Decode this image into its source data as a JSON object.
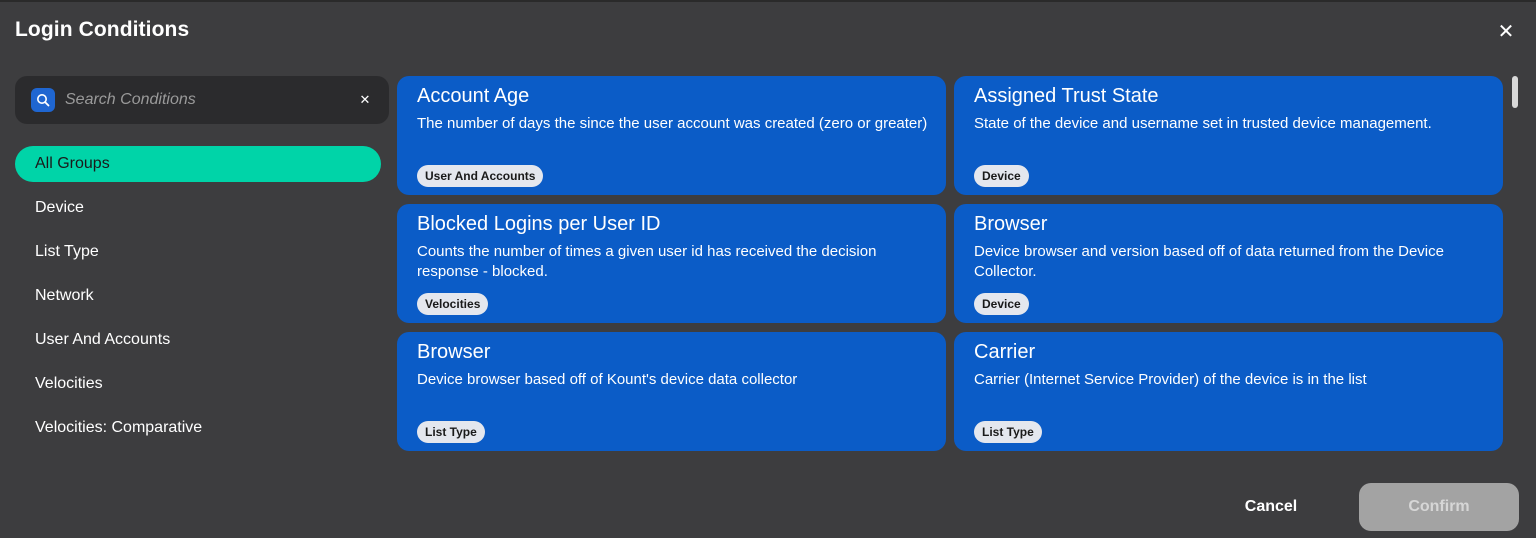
{
  "dialog": {
    "title": "Login Conditions"
  },
  "search": {
    "placeholder": "Search Conditions",
    "value": ""
  },
  "groups": [
    {
      "label": "All Groups",
      "active": true
    },
    {
      "label": "Device",
      "active": false
    },
    {
      "label": "List Type",
      "active": false
    },
    {
      "label": "Network",
      "active": false
    },
    {
      "label": "User And Accounts",
      "active": false
    },
    {
      "label": "Velocities",
      "active": false
    },
    {
      "label": "Velocities: Comparative",
      "active": false
    }
  ],
  "cards": [
    {
      "title": "Account Age",
      "description": "The number of days the since the user account was created (zero or greater)",
      "tag": "User And Accounts"
    },
    {
      "title": "Assigned Trust State",
      "description": "State of the device and username set in trusted device management.",
      "tag": "Device"
    },
    {
      "title": "Blocked Logins per User ID",
      "description": "Counts the number of times a given user id has received the decision response - blocked.",
      "tag": "Velocities"
    },
    {
      "title": "Browser",
      "description": "Device browser and version based off of data returned from the Device Collector.",
      "tag": "Device"
    },
    {
      "title": "Browser",
      "description": "Device browser based off of Kount's device data collector",
      "tag": "List Type"
    },
    {
      "title": "Carrier",
      "description": "Carrier (Internet Service Provider) of the device is in the list",
      "tag": "List Type"
    }
  ],
  "footer": {
    "cancel_label": "Cancel",
    "confirm_label": "Confirm"
  },
  "icons": {
    "close": "close-icon",
    "search": "search-icon",
    "clear": "clear-icon"
  },
  "colors": {
    "accent": "#00d4a8",
    "card": "#0b5cc7",
    "background": "#3d3d3f",
    "confirm_disabled": "#a3a3a3"
  }
}
